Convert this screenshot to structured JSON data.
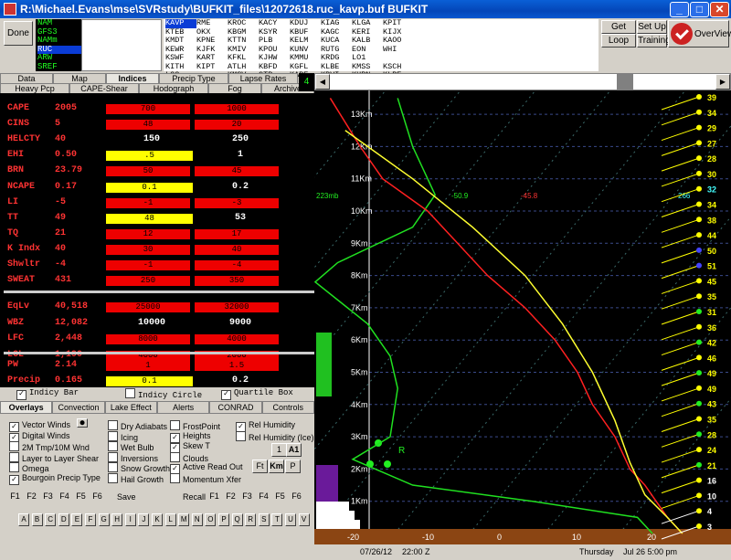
{
  "window": {
    "title": "R:\\Michael.Evans\\mse\\SVRstudy\\BUFKIT_files\\12072618.ruc_kavp.buf BUFKIT",
    "min": "_",
    "max": "□",
    "close": "✕"
  },
  "top": {
    "done": "Done",
    "models": [
      "NAM",
      "GFS3",
      "NAMm",
      "RUC",
      "ARW",
      "SREF"
    ],
    "selected_model": "RUC",
    "stations": [
      "KAVP",
      "RME",
      "KROC",
      "KACY",
      "KDUJ",
      "KIAG",
      "KLGA",
      "KPIT",
      "KTEB",
      "OKX",
      "KBGM",
      "KSYR",
      "KBUF",
      "KAGC",
      "KERI",
      "KIJX",
      "KMDT",
      "KPNE",
      "KTTN",
      "PLB",
      "KELM",
      "KUCA",
      "KALB",
      "KAOO",
      "KEWR",
      "KJFK",
      "KMIV",
      "KPOU",
      "KUNV",
      "RUTG",
      "EON",
      "WHI",
      "KSWF",
      "KART",
      "KFKL",
      "KJHW",
      "KMMU",
      "KRDG",
      "LO1",
      "",
      "KITH",
      "KIPT",
      "ATLH",
      "KBFD",
      "KGFL",
      "KLBE",
      "KMSS",
      "KSCH",
      "LO2",
      "",
      "KMSV",
      "GTB",
      "KABE",
      "KBVI",
      "KHPN",
      "KLBE",
      "KPHL",
      "KSLK",
      "OGS",
      ""
    ],
    "selected_station": "KAVP",
    "buttons": {
      "get_data": "Get Data",
      "set_up": "Set Up",
      "loop": "Loop",
      "training": "Training",
      "overview": "OverView"
    }
  },
  "tabs": {
    "row1": [
      "Data",
      "Map",
      "Indices",
      "Precip Type",
      "Lapse Rates"
    ],
    "row2": [
      "Heavy Pcp",
      "CAPE-Shear",
      "Hodograph",
      "Fog",
      "Archive"
    ],
    "active": "Indices",
    "frame": "4"
  },
  "indices": [
    {
      "name": "CAPE",
      "value": "2005",
      "bars": [
        {
          "label": "700",
          "color": "#e00",
          "x": 108,
          "w": 92
        },
        {
          "label": "1000",
          "color": "#e00",
          "x": 205,
          "w": 92
        }
      ]
    },
    {
      "name": "CINS",
      "value": "5",
      "bars": [
        {
          "label": "48",
          "color": "#e00",
          "x": 108,
          "w": 92
        },
        {
          "label": "20",
          "color": "#e00",
          "x": 205,
          "w": 92
        }
      ]
    },
    {
      "name": "HELCTY",
      "value": "40",
      "nums": [
        "150",
        "250"
      ]
    },
    {
      "name": "EHI",
      "value": "0.50",
      "bars": [
        {
          "label": ".5",
          "color": "#ff0",
          "x": 108,
          "w": 95
        }
      ],
      "nums2": [
        "1"
      ]
    },
    {
      "name": "BRN",
      "value": "23.79",
      "bars": [
        {
          "label": "50",
          "color": "#e00",
          "x": 108,
          "w": 92
        },
        {
          "label": "45",
          "color": "#e00",
          "x": 205,
          "w": 92
        }
      ]
    },
    {
      "name": "NCAPE",
      "value": "0.17",
      "bars": [
        {
          "label": "0.1",
          "color": "#ff0",
          "x": 108,
          "w": 95
        }
      ],
      "nums2": [
        "0.2"
      ]
    },
    {
      "name": "LI",
      "value": "-5",
      "bars": [
        {
          "label": "-1",
          "color": "#e00",
          "x": 108,
          "w": 92
        },
        {
          "label": "-3",
          "color": "#e00",
          "x": 205,
          "w": 92
        }
      ]
    },
    {
      "name": "TT",
      "value": "49",
      "bars": [
        {
          "label": "48",
          "color": "#ff0",
          "x": 108,
          "w": 95
        }
      ],
      "nums2": [
        "53"
      ]
    },
    {
      "name": "TQ",
      "value": "21",
      "bars": [
        {
          "label": "12",
          "color": "#e00",
          "x": 108,
          "w": 92
        },
        {
          "label": "17",
          "color": "#e00",
          "x": 205,
          "w": 92
        }
      ]
    },
    {
      "name": "K Indx",
      "value": "40",
      "bars": [
        {
          "label": "30",
          "color": "#e00",
          "x": 108,
          "w": 92
        },
        {
          "label": "40",
          "color": "#e00",
          "x": 205,
          "w": 92
        }
      ]
    },
    {
      "name": "Shwltr",
      "value": "-4",
      "bars": [
        {
          "label": "-1",
          "color": "#e00",
          "x": 108,
          "w": 92
        },
        {
          "label": "-4",
          "color": "#e00",
          "x": 205,
          "w": 92
        }
      ]
    },
    {
      "name": "SWEAT",
      "value": "431",
      "bars": [
        {
          "label": "250",
          "color": "#e00",
          "x": 108,
          "w": 92
        },
        {
          "label": "350",
          "color": "#e00",
          "x": 205,
          "w": 92
        }
      ]
    }
  ],
  "indices2": [
    {
      "name": "EqLv",
      "value": "40,518",
      "bars": [
        {
          "label": "25000",
          "color": "#e00",
          "x": 108,
          "w": 92
        },
        {
          "label": "32000",
          "color": "#e00",
          "x": 205,
          "w": 92
        }
      ]
    },
    {
      "name": "WBZ",
      "value": "12,082",
      "nums": [
        "10000",
        "9000"
      ]
    },
    {
      "name": "LFC",
      "value": "2,448",
      "bars": [
        {
          "label": "8000",
          "color": "#e00",
          "x": 108,
          "w": 92
        },
        {
          "label": "4000",
          "color": "#e00",
          "x": 205,
          "w": 92
        }
      ]
    },
    {
      "name": "LCL",
      "value": "1,190",
      "bars": [
        {
          "label": "4000",
          "color": "#e00",
          "x": 108,
          "w": 92
        },
        {
          "label": "2000",
          "color": "#e00",
          "x": 205,
          "w": 92
        }
      ]
    }
  ],
  "indices3": [
    {
      "name": "PW",
      "value": "2.14",
      "bars": [
        {
          "label": "1",
          "color": "#e00",
          "x": 108,
          "w": 92
        },
        {
          "label": "1.5",
          "color": "#e00",
          "x": 205,
          "w": 92
        }
      ]
    },
    {
      "name": "Precip",
      "value": "0.165",
      "bars": [
        {
          "label": "0.1",
          "color": "#ff0",
          "x": 108,
          "w": 95
        }
      ],
      "nums2": [
        "0.2"
      ]
    }
  ],
  "ind_checks": {
    "bar": "Indicy Bar",
    "circle": "Indicy Circle",
    "quartile": "Quartile Box"
  },
  "overlay_tabs": [
    "Overlays",
    "Convection",
    "Lake Effect",
    "Alerts",
    "CONRAD",
    "Controls"
  ],
  "overlays": {
    "col1": [
      {
        "l": "Vector Winds",
        "on": true
      },
      {
        "l": "Digital Winds",
        "on": true
      },
      {
        "l": "2M Tmp/10M Wnd",
        "on": false
      },
      {
        "l": "Layer to Layer Shear",
        "on": false
      },
      {
        "l": "Omega",
        "on": false
      },
      {
        "l": "Bourgoin Precip Type",
        "on": true
      }
    ],
    "col2": [
      {
        "l": "Dry Adiabats",
        "on": false
      },
      {
        "l": "Icing",
        "on": false
      },
      {
        "l": "Wet Bulb",
        "on": false
      },
      {
        "l": "Inversions",
        "on": false
      },
      {
        "l": "Snow Growth",
        "on": false
      },
      {
        "l": "Hail Growth",
        "on": false
      }
    ],
    "col3": [
      {
        "l": "FrostPoint",
        "on": false
      },
      {
        "l": "Heights",
        "on": true
      },
      {
        "l": "Skew T",
        "on": true
      },
      {
        "l": "Clouds",
        "on": false
      },
      {
        "l": "Active Read Out",
        "on": true
      },
      {
        "l": "Momentum Xfer",
        "on": false
      }
    ],
    "col4": [
      {
        "l": "Rel Humidity",
        "on": true
      },
      {
        "l": "Rel Humidity (Ice)",
        "on": false
      }
    ],
    "small": [
      "1",
      "A1",
      "Ft",
      "Km",
      "P"
    ],
    "fkeys": [
      "F1",
      "F2",
      "F3",
      "F4",
      "F5",
      "F6"
    ],
    "save": "Save",
    "recall": "Recall",
    "letters": [
      "A",
      "B",
      "C",
      "D",
      "E",
      "F",
      "G",
      "H",
      "I",
      "J",
      "K",
      "L",
      "M",
      "N",
      "O",
      "P",
      "Q",
      "R",
      "S",
      "T",
      "U",
      "V"
    ]
  },
  "plot": {
    "heights_km": [
      "1Km",
      "2Km",
      "3Km",
      "4Km",
      "5Km",
      "6Km",
      "7Km",
      "8Km",
      "9Km",
      "10Km",
      "11Km",
      "12Km",
      "13Km"
    ],
    "x_ticks": [
      "-20",
      "-10",
      "0",
      "10",
      "20"
    ],
    "annot": {
      "p": "223mb",
      "td": "-50.9",
      "t": "-45.8",
      "w": "266",
      "w2": "32",
      "r": "R"
    },
    "winds": [
      "39",
      "34",
      "29",
      "27",
      "28",
      "30",
      "32",
      "34",
      "38",
      "44",
      "50",
      "51",
      "45",
      "35",
      "31",
      "36",
      "42",
      "46",
      "49",
      "49",
      "43",
      "35",
      "28",
      "24",
      "21",
      "16",
      "10",
      "4",
      "3"
    ]
  },
  "status": {
    "date": "07/26/12",
    "time": "22:00 Z",
    "day": "Thursday",
    "local": "Jul 26  5:00 pm"
  },
  "colors": {
    "temp": "#ff2020",
    "dewpoint": "#20e020",
    "parcel": "#ffff30",
    "grid": "#3a4a8a",
    "ground": "#8b4513"
  }
}
